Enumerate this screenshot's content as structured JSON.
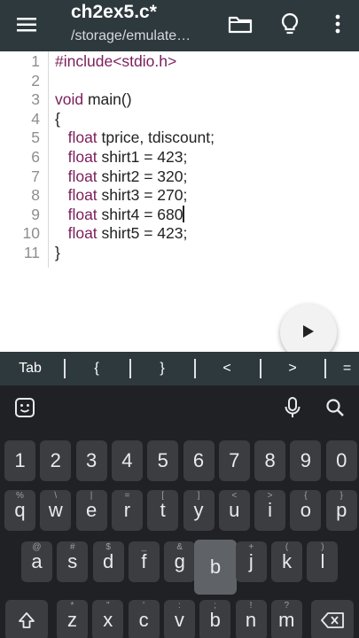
{
  "toolbar": {
    "title": "ch2ex5.c*",
    "subtitle": "/storage/emulate…",
    "icons": [
      "menu-icon",
      "folder-icon",
      "lightbulb-icon",
      "more-vert-icon"
    ]
  },
  "editor": {
    "lines": [
      {
        "num": "1",
        "parts": [
          {
            "t": "#include<stdio.h>",
            "k": true
          }
        ]
      },
      {
        "num": "2",
        "parts": []
      },
      {
        "num": "3",
        "parts": [
          {
            "t": "void",
            "k": true
          },
          {
            "t": " main()",
            "k": false
          }
        ]
      },
      {
        "num": "4",
        "parts": [
          {
            "t": "{",
            "k": false
          }
        ]
      },
      {
        "num": "5",
        "parts": [
          {
            "t": "   ",
            "k": false
          },
          {
            "t": "float",
            "k": true
          },
          {
            "t": " tprice, tdiscount;",
            "k": false
          }
        ]
      },
      {
        "num": "6",
        "parts": [
          {
            "t": "   ",
            "k": false
          },
          {
            "t": "float",
            "k": true
          },
          {
            "t": " shirt1 = 423;",
            "k": false
          }
        ]
      },
      {
        "num": "7",
        "parts": [
          {
            "t": "   ",
            "k": false
          },
          {
            "t": "float",
            "k": true
          },
          {
            "t": " shirt2 = 320;",
            "k": false
          }
        ]
      },
      {
        "num": "8",
        "parts": [
          {
            "t": "   ",
            "k": false
          },
          {
            "t": "float",
            "k": true
          },
          {
            "t": " shirt3 = 270;",
            "k": false
          }
        ]
      },
      {
        "num": "9",
        "parts": [
          {
            "t": "   ",
            "k": false
          },
          {
            "t": "float",
            "k": true
          },
          {
            "t": " shirt4 = 680",
            "k": false
          }
        ],
        "cursor": true
      },
      {
        "num": "10",
        "parts": [
          {
            "t": "   ",
            "k": false
          },
          {
            "t": "float",
            "k": true
          },
          {
            "t": " shirt5 = 423;",
            "k": false
          }
        ]
      },
      {
        "num": "11",
        "parts": [
          {
            "t": "}",
            "k": false
          }
        ]
      }
    ],
    "keyword_color": "#7b1e5a",
    "run_icon": "play-icon"
  },
  "symbol_bar": {
    "items": [
      "Tab",
      "{",
      "}",
      "<",
      ">",
      "="
    ]
  },
  "keyboard": {
    "top_icons": [
      "emoji-icon",
      "microphone-icon",
      "search-icon"
    ],
    "row_numbers": [
      "1",
      "2",
      "3",
      "4",
      "5",
      "6",
      "7",
      "8",
      "9",
      "0"
    ],
    "row1": [
      {
        "k": "q",
        "h": "%"
      },
      {
        "k": "w",
        "h": "\\"
      },
      {
        "k": "e",
        "h": "|"
      },
      {
        "k": "r",
        "h": "="
      },
      {
        "k": "t",
        "h": "["
      },
      {
        "k": "y",
        "h": "]"
      },
      {
        "k": "u",
        "h": "<"
      },
      {
        "k": "i",
        "h": ">"
      },
      {
        "k": "o",
        "h": "{"
      },
      {
        "k": "p",
        "h": "}"
      }
    ],
    "row2": [
      {
        "k": "a",
        "h": "@"
      },
      {
        "k": "s",
        "h": "#"
      },
      {
        "k": "d",
        "h": "$"
      },
      {
        "k": "f",
        "h": "_"
      },
      {
        "k": "g",
        "h": "&"
      },
      {
        "k": "b",
        "h": ""
      },
      {
        "k": "j",
        "h": "+"
      },
      {
        "k": "k",
        "h": "("
      },
      {
        "k": "l",
        "h": ")"
      }
    ],
    "row3": [
      {
        "k": "z",
        "h": "*"
      },
      {
        "k": "x",
        "h": "\""
      },
      {
        "k": "c",
        "h": "'"
      },
      {
        "k": "v",
        "h": ":"
      },
      {
        "k": "b",
        "h": ";"
      },
      {
        "k": "n",
        "h": "!"
      },
      {
        "k": "m",
        "h": "?"
      }
    ],
    "shift_icon": "shift-icon",
    "backspace_icon": "backspace-icon",
    "pressed_key": "b"
  }
}
